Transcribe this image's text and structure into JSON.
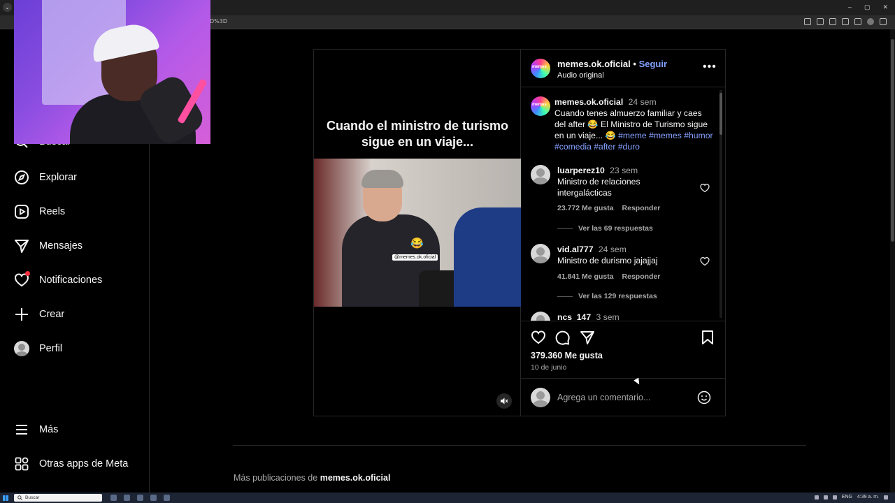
{
  "browser": {
    "url_fragment": "D%3D",
    "window_controls": [
      "–",
      "▢",
      "✕"
    ]
  },
  "sidebar": {
    "items": [
      {
        "label": "Buscar",
        "icon": "search-icon"
      },
      {
        "label": "Explorar",
        "icon": "compass-icon"
      },
      {
        "label": "Reels",
        "icon": "reels-icon"
      },
      {
        "label": "Mensajes",
        "icon": "send-icon"
      },
      {
        "label": "Notificaciones",
        "icon": "heart-icon"
      },
      {
        "label": "Crear",
        "icon": "plus-icon"
      },
      {
        "label": "Perfil",
        "icon": "profile-avatar"
      }
    ],
    "bottom": [
      {
        "label": "Más",
        "icon": "menu-icon"
      },
      {
        "label": "Otras apps de Meta",
        "icon": "apps-icon"
      }
    ]
  },
  "post": {
    "media": {
      "caption": "Cuando el ministro de turismo sigue en un viaje...",
      "emoji": "😂",
      "watermark": "@memes.ok.oficial"
    },
    "header": {
      "username": "memes.ok.oficial",
      "separator": "•",
      "follow": "Seguir",
      "audio": "Audio original"
    },
    "caption": {
      "username": "memes.ok.oficial",
      "time": "24 sem",
      "text": "Cuando tenes almuerzo familiar y caes del after 😂 El Ministro de Turismo sigue en un viaje... 😂",
      "hashtags": "#meme #memes #humor #comedia #after #duro"
    },
    "comments": [
      {
        "username": "luarperez10",
        "time": "23 sem",
        "text": "Ministro de relaciones intergalácticas",
        "likes": "23.772 Me gusta",
        "reply": "Responder",
        "replies": "Ver las 69 respuestas"
      },
      {
        "username": "vid.al777",
        "time": "24 sem",
        "text": "Ministro de durismo jajajjaj",
        "likes": "41.841 Me gusta",
        "reply": "Responder",
        "replies": "Ver las 129 respuestas"
      },
      {
        "username": "ncs_147",
        "time": "3 sem"
      }
    ],
    "likes": "379.360 Me gusta",
    "date": "10 de junio",
    "add_comment_placeholder": "Agrega un comentario..."
  },
  "footer": {
    "more_prefix": "Más publicaciones de",
    "more_user": "memes.ok.oficial"
  },
  "taskbar": {
    "search": "Buscar",
    "lang": "ENG",
    "time": "4:39 a. m."
  },
  "colors": {
    "background": "#000000",
    "link": "#84a0ff",
    "secondary_text": "#a8a8a8",
    "notification_dot": "#ff3040"
  }
}
